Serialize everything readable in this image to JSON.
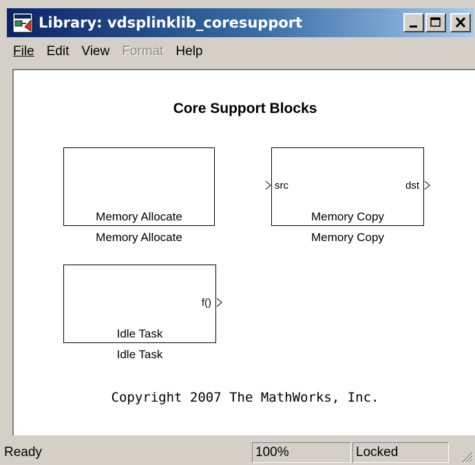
{
  "window": {
    "title": "Library: vdsplinklib_coresupport"
  },
  "menu": [
    {
      "label": "File",
      "enabled": true
    },
    {
      "label": "Edit",
      "enabled": true
    },
    {
      "label": "View",
      "enabled": true
    },
    {
      "label": "Format",
      "enabled": false
    },
    {
      "label": "Help",
      "enabled": true
    }
  ],
  "canvas": {
    "title": "Core Support Blocks",
    "blocks": {
      "memory_allocate": {
        "inner_label": "Memory Allocate",
        "caption": "Memory Allocate"
      },
      "memory_copy": {
        "inner_label": "Memory Copy",
        "caption": "Memory Copy",
        "input_port": "src",
        "output_port": "dst"
      },
      "idle_task": {
        "inner_label": "Idle Task",
        "caption": "Idle Task",
        "output_port": "f()"
      }
    },
    "copyright": "Copyright 2007 The MathWorks, Inc."
  },
  "status": {
    "text": "Ready",
    "zoom": "100%",
    "lock_state": "Locked"
  },
  "colors": {
    "titlebar_start": "#0a246a",
    "titlebar_end": "#a6caf0",
    "chrome": "#d4d0c8"
  }
}
